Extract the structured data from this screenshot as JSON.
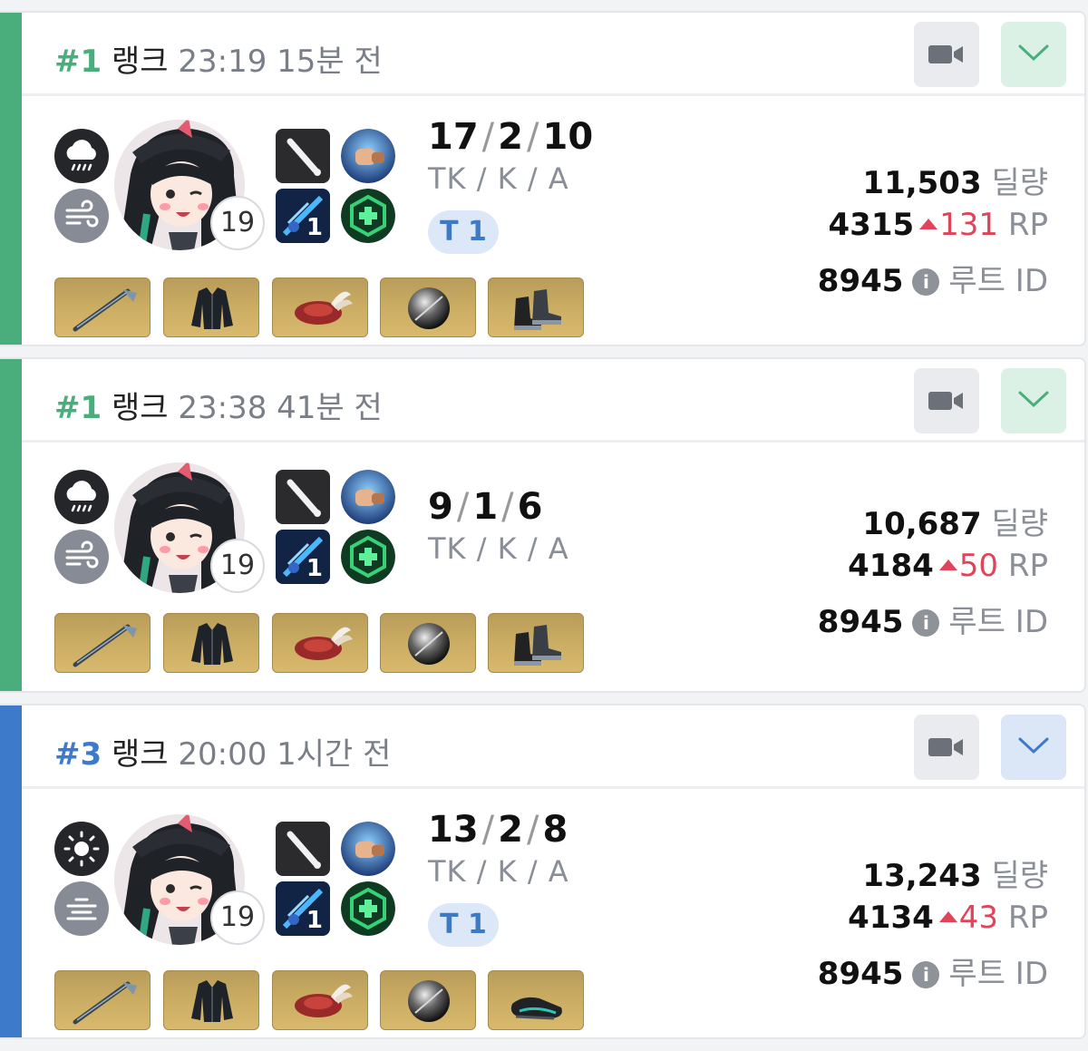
{
  "matches": [
    {
      "rank": "#1",
      "rank_label": "랭크",
      "time": "23:19",
      "ago": "15분 전",
      "accent": "#4aae7c",
      "toggle_bg": "#dcf1e6",
      "weather1": "rain-cloud-icon",
      "weather2": "wind-icon",
      "level": "19",
      "skill_count": "1",
      "kda": [
        "17",
        "2",
        "10"
      ],
      "kda_label": "TK / K / A",
      "tier": "T 1",
      "damage": "11,503",
      "damage_unit": "딜량",
      "rp": "4315",
      "rp_change": "131",
      "rp_unit": "RP",
      "route_id": "8945",
      "route_unit": "루트 ID",
      "items": [
        "spear-item-icon",
        "jacket-item-icon",
        "crest-item-icon",
        "disc-item-icon",
        "boots-item-icon"
      ]
    },
    {
      "rank": "#1",
      "rank_label": "랭크",
      "time": "23:38",
      "ago": "41분 전",
      "accent": "#4aae7c",
      "toggle_bg": "#dcf1e6",
      "weather1": "rain-cloud-icon",
      "weather2": "wind-icon",
      "level": "19",
      "skill_count": "1",
      "kda": [
        "9",
        "1",
        "6"
      ],
      "kda_label": "TK / K / A",
      "tier": "",
      "damage": "10,687",
      "damage_unit": "딜량",
      "rp": "4184",
      "rp_change": "50",
      "rp_unit": "RP",
      "route_id": "8945",
      "route_unit": "루트 ID",
      "items": [
        "spear-item-icon",
        "jacket-item-icon",
        "crest-item-icon",
        "disc-item-icon",
        "boots-item-icon"
      ]
    },
    {
      "rank": "#3",
      "rank_label": "랭크",
      "time": "20:00",
      "ago": "1시간 전",
      "accent": "#3d7ac9",
      "toggle_bg": "#dbe6f6",
      "weather1": "sun-icon",
      "weather2": "fog-icon",
      "level": "19",
      "skill_count": "1",
      "kda": [
        "13",
        "2",
        "8"
      ],
      "kda_label": "TK / K / A",
      "tier": "T 1",
      "damage": "13,243",
      "damage_unit": "딜량",
      "rp": "4134",
      "rp_change": "43",
      "rp_unit": "RP",
      "route_id": "8945",
      "route_unit": "루트 ID",
      "items": [
        "spear-item-icon",
        "jacket-item-icon",
        "crest-item-icon",
        "disc-item-icon",
        "shoes-item-icon"
      ]
    }
  ]
}
